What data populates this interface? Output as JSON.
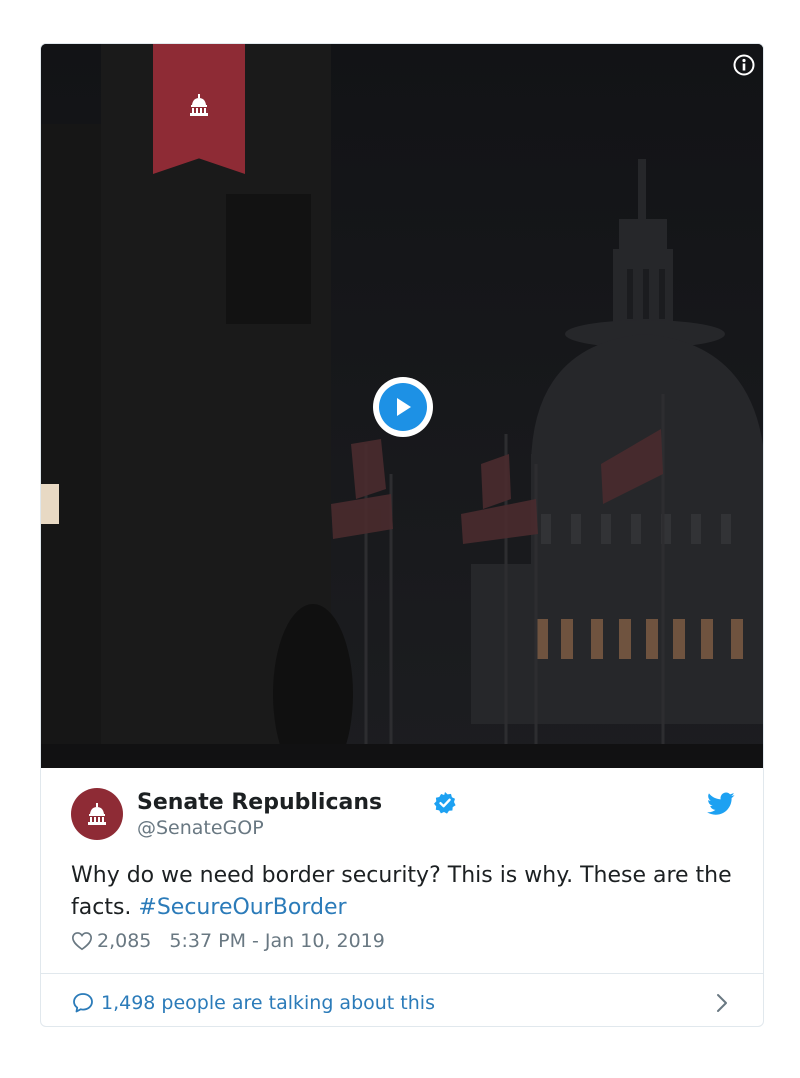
{
  "media": {
    "ribbon_icon": "capitol-dome-icon",
    "info_icon": "info-icon",
    "play_icon": "play-icon"
  },
  "tweet": {
    "author_name": "Senate Republicans",
    "author_handle": "@SenateGOP",
    "verified_icon": "verified-badge-icon",
    "platform_icon": "twitter-bird-icon",
    "text": "Why do we need border security? This is why. These are the facts. ",
    "hashtag": "#SecureOurBorder",
    "likes": "2,085",
    "timestamp": "5:37 PM - Jan 10, 2019",
    "talking": "1,498 people are talking about this"
  },
  "colors": {
    "brand_red": "#8e2b35",
    "link_blue": "#2b7bb9",
    "twitter_blue": "#1da1f2",
    "muted_gray": "#697882"
  }
}
